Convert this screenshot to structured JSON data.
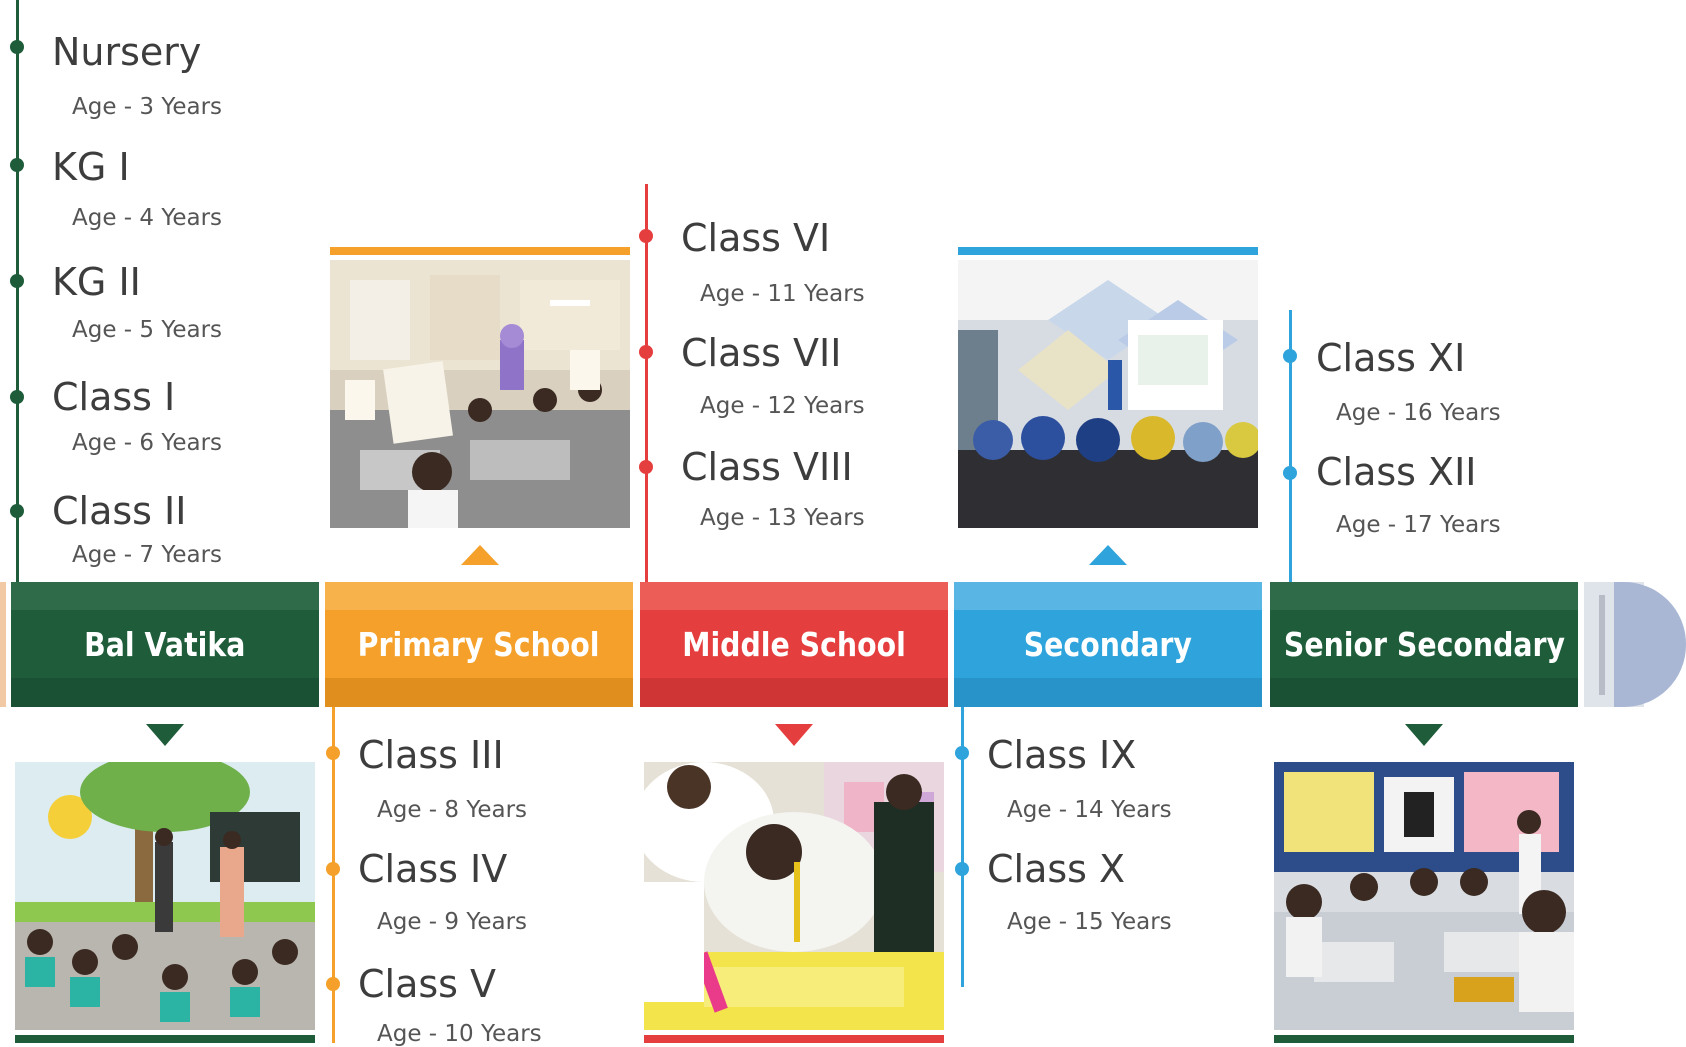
{
  "colors": {
    "green": "#1e5c3a",
    "orange": "#f4a02a",
    "red": "#e53e3e",
    "blue": "#2ea3dc",
    "end_cap": "#a9b7d4"
  },
  "stages": [
    {
      "label": "Bal Vatika",
      "color": "green",
      "icon": "classroom-photo"
    },
    {
      "label": "Primary School",
      "color": "orange",
      "icon": "classroom-photo"
    },
    {
      "label": "Middle School",
      "color": "red",
      "icon": "classroom-photo"
    },
    {
      "label": "Secondary",
      "color": "blue",
      "icon": "classroom-photo"
    },
    {
      "label": "Senior Secondary",
      "color": "green",
      "icon": "classroom-photo"
    }
  ],
  "bal_vatika": {
    "classes": [
      {
        "name": "Nursery",
        "age": "Age - 3 Years"
      },
      {
        "name": "KG I",
        "age": "Age - 4 Years"
      },
      {
        "name": "KG II",
        "age": "Age - 5 Years"
      },
      {
        "name": "Class I",
        "age": "Age - 6 Years"
      },
      {
        "name": "Class II",
        "age": "Age - 7 Years"
      }
    ]
  },
  "primary": {
    "classes": [
      {
        "name": "Class III",
        "age": "Age - 8 Years"
      },
      {
        "name": "Class IV",
        "age": "Age - 9 Years"
      },
      {
        "name": "Class V",
        "age": "Age - 10 Years"
      }
    ]
  },
  "middle": {
    "classes": [
      {
        "name": "Class VI",
        "age": "Age - 11 Years"
      },
      {
        "name": "Class VII",
        "age": "Age - 12 Years"
      },
      {
        "name": "Class VIII",
        "age": "Age - 13 Years"
      }
    ]
  },
  "secondary": {
    "classes": [
      {
        "name": "Class IX",
        "age": "Age - 14 Years"
      },
      {
        "name": "Class X",
        "age": "Age - 15 Years"
      }
    ]
  },
  "senior": {
    "classes": [
      {
        "name": "Class XI",
        "age": "Age - 16 Years"
      },
      {
        "name": "Class XII",
        "age": "Age - 17 Years"
      }
    ]
  }
}
